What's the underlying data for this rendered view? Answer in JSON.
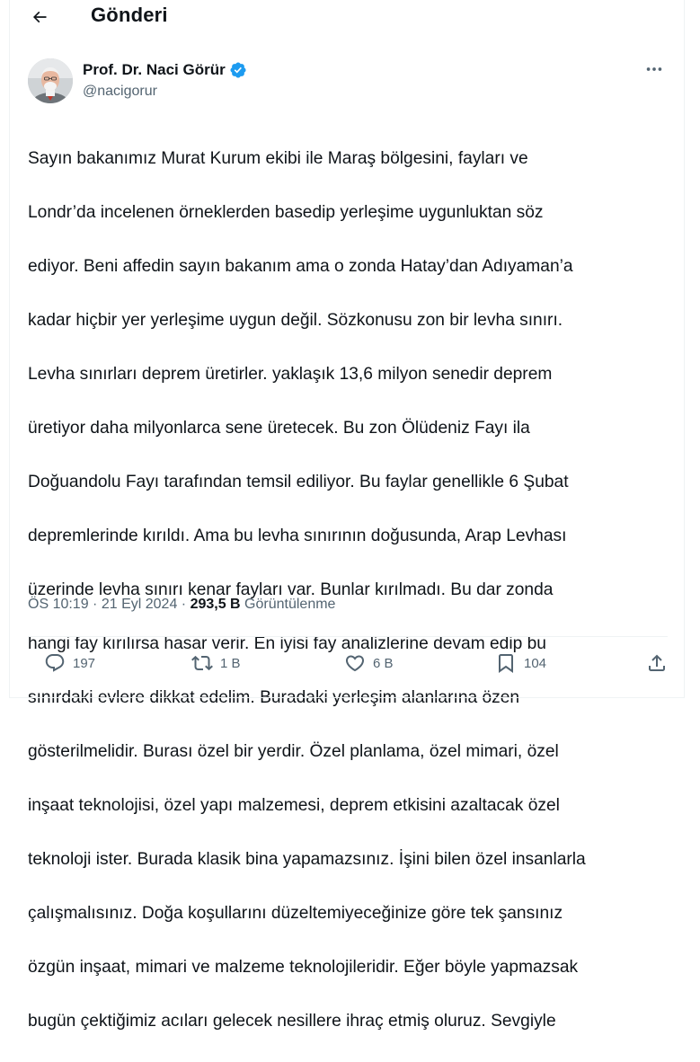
{
  "header": {
    "back_icon": "arrow-left-icon",
    "title": "Gönderi"
  },
  "author": {
    "name": "Prof. Dr. Naci Görür",
    "handle": "@nacigorur",
    "verified_icon": "verified-badge-icon",
    "verified_color": "#1d9bf0",
    "more_icon": "more-horizontal-icon"
  },
  "tweet": {
    "lines": [
      "Sayın bakanımız Murat Kurum ekibi ile Maraş bölgesini, fayları ve",
      "Londr’da incelenen örneklerden basedip yerleşime uygunluktan söz",
      "ediyor. Beni affedin sayın bakanım ama o zonda Hatay’dan Adıyaman’a",
      "kadar hiçbir yer yerleşime uygun değil. Sözkonusu zon bir levha sınırı.",
      "Levha sınırları deprem üretirler. yaklaşık 13,6 milyon senedir deprem",
      "üretiyor daha milyonlarca sene üretecek. Bu zon Ölüdeniz Fayı ila",
      "Doğuandolu  Fayı tarafından temsil ediliyor. Bu faylar genellikle 6 Şubat",
      "depremlerinde kırıldı. Ama bu levha sınırının doğusunda, Arap Levhası",
      "üzerinde levha sınırı kenar fayları var. Bunlar kırılmadı. Bu dar zonda",
      "hangi fay kırılırsa hasar verir. En iyisi fay analizlerine devam edip bu",
      "sınırdaki evlere dikkat edelim. Buradaki yerleşim alanlarına özen",
      "gösterilmelidir. Burası özel bir yerdir. Özel planlama, özel mimari, özel",
      "inşaat teknolojisi, özel yapı malzemesi, deprem etkisini azaltacak özel",
      "teknoloji ister. Burada klasik bina yapamazsınız. İşini bilen özel insanlarla",
      "çalışmalısınız. Doğa koşullarını düzeltemiyeceğinize göre tek şansınız",
      "özgün inşaat, mimari ve malzeme teknolojileridir. Eğer böyle yapmazsak",
      "bugün çektiğimiz acıları gelecek nesillere ihraç etmiş oluruz. Sevgiyle"
    ]
  },
  "meta": {
    "time": "ÖS 10:19",
    "sep1": " · ",
    "date": "21 Eyl 2024",
    "sep2": " · ",
    "views_count": "293,5 B",
    "views_label": " Görüntülenme"
  },
  "actions": {
    "reply": {
      "icon": "reply-icon",
      "count": "197"
    },
    "retweet": {
      "icon": "retweet-icon",
      "count": "1 B"
    },
    "like": {
      "icon": "heart-icon",
      "count": "6 B"
    },
    "bookmark": {
      "icon": "bookmark-icon",
      "count": "104"
    },
    "share": {
      "icon": "share-icon"
    }
  },
  "colors": {
    "text": "#0f1419",
    "secondary": "#536471",
    "border": "#eff3f4",
    "accent": "#1d9bf0"
  }
}
